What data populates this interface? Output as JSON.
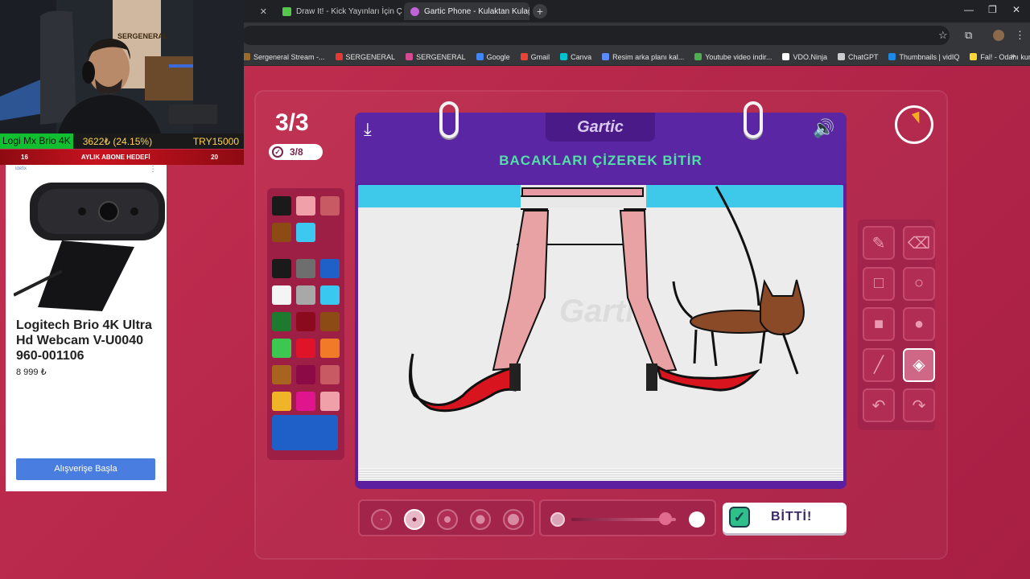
{
  "browser": {
    "tabs": [
      {
        "label": "",
        "active": false
      },
      {
        "label": "Draw It! - Kick Yayınları İçin Çiz",
        "active": false
      },
      {
        "label": "Gartic Phone - Kulaktan Kulağa",
        "active": true
      }
    ],
    "new_tab": "+",
    "window_controls": {
      "minimize": "—",
      "maximize": "❐",
      "close": "✕"
    },
    "bookmarks": [
      {
        "label": "Sergeneral Stream -...",
        "color": "#9b6a2e"
      },
      {
        "label": "SERGENERAL",
        "color": "#e53935"
      },
      {
        "label": "SERGENERAL",
        "color": "#d64a91"
      },
      {
        "label": "Google",
        "color": "#4285f4"
      },
      {
        "label": "Gmail",
        "color": "#ea4335"
      },
      {
        "label": "Canva",
        "color": "#00c4cc"
      },
      {
        "label": "Resim arka planı kal...",
        "color": "#5b8bff"
      },
      {
        "label": "Youtube video indir...",
        "color": "#4caf50"
      },
      {
        "label": "VDO.Ninja",
        "color": "#ffffff"
      },
      {
        "label": "ChatGPT",
        "color": "#cccccc"
      },
      {
        "label": "Thumbnails | vidIQ",
        "color": "#1e88e5"
      },
      {
        "label": "Fal! - Odanı kur ar...",
        "color": "#fdd835"
      }
    ],
    "bookmarks_overflow": "»"
  },
  "game": {
    "round": "3/3",
    "players_done": "3/8",
    "logo": "Gartic",
    "prompt": "BACAKLARI ÇİZEREK BİTİR",
    "done_label": "BİTTİ!",
    "palette_colors": [
      "#1a1a1a",
      "#f0a0a8",
      "#c85a64",
      "#8c4a14",
      "#3cc8f0",
      "#1a1a1a",
      "#6e6e6e",
      "#1e5fc8",
      "#f4f4f4",
      "#a8a8a8",
      "#38c8f0",
      "#1e7a2e",
      "#8c0a1e",
      "#8c4a14",
      "#3cc850",
      "#e01428",
      "#f07a28",
      "#a8641e",
      "#8c0a46",
      "#c85a64",
      "#f0b428",
      "#e0148c",
      "#f0a0a8"
    ],
    "selected_color": "#1e5fc8",
    "tools": [
      {
        "icon": "pencil-icon",
        "glyph": "✎",
        "active": false
      },
      {
        "icon": "eraser-icon",
        "glyph": "⌫",
        "active": false
      },
      {
        "icon": "rectangle-outline-icon",
        "glyph": "□",
        "active": false
      },
      {
        "icon": "ellipse-outline-icon",
        "glyph": "○",
        "active": false
      },
      {
        "icon": "rectangle-filled-icon",
        "glyph": "■",
        "active": false
      },
      {
        "icon": "ellipse-filled-icon",
        "glyph": "●",
        "active": false
      },
      {
        "icon": "line-icon",
        "glyph": "╱",
        "active": false
      },
      {
        "icon": "fill-bucket-icon",
        "glyph": "◈",
        "active": true
      },
      {
        "icon": "undo-icon",
        "glyph": "↶",
        "active": false
      },
      {
        "icon": "redo-icon",
        "glyph": "↷",
        "active": false
      }
    ],
    "brush_sizes": 5,
    "selected_brush_size": 2,
    "opacity_level": 0.9
  },
  "stream": {
    "product_name": "Logi Mx Brio 4K",
    "donation_progress": "3622₺ (24.15%)",
    "donation_goal": "TRY15000",
    "sub_goal_current": "16",
    "sub_goal_label": "AYLIK ABONE HEDEFİ",
    "sub_goal_target": "20"
  },
  "ad": {
    "tag": "idefix",
    "more": "⋮",
    "title": "Logitech Brio 4K Ultra Hd Webcam V-U0040 960-001106",
    "price": "8 999 ₺",
    "cta": "Alışverişe Başla"
  }
}
